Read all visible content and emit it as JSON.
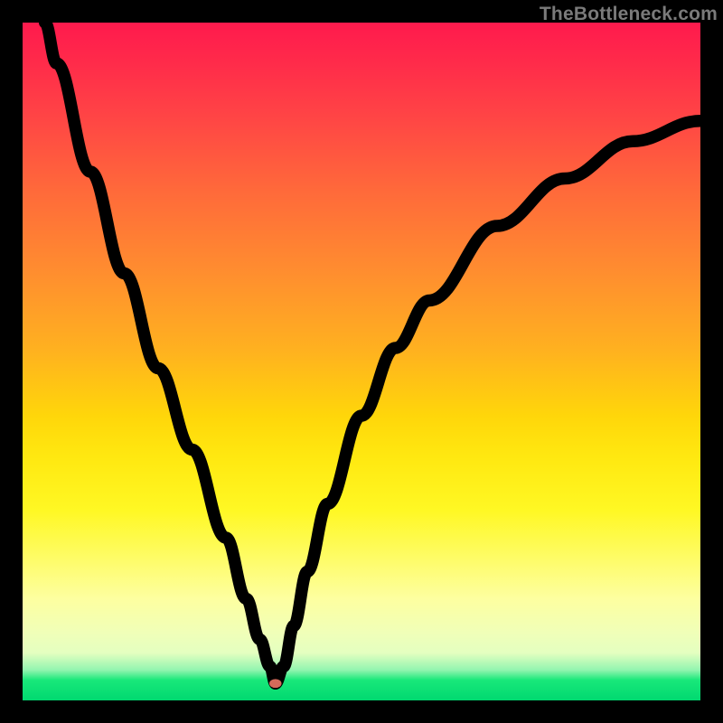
{
  "watermark": "TheBottleneck.com",
  "chart_data": {
    "type": "line",
    "title": "",
    "xlabel": "",
    "ylabel": "",
    "xlim": [
      0,
      100
    ],
    "ylim": [
      0,
      100
    ],
    "grid": false,
    "legend": false,
    "background": "rainbow-gradient-vertical",
    "marker": {
      "x": 37.3,
      "y": 2.5,
      "color": "#d46a5a"
    },
    "series": [
      {
        "name": "left-branch",
        "x": [
          3.3,
          5,
          10,
          15,
          20,
          25,
          30,
          33,
          35,
          36.5,
          37.3
        ],
        "y": [
          100,
          94,
          78,
          63,
          49,
          37,
          24,
          15,
          9,
          5,
          2.5
        ]
      },
      {
        "name": "right-branch",
        "x": [
          37.3,
          38.5,
          40,
          42,
          45,
          50,
          55,
          60,
          70,
          80,
          90,
          100
        ],
        "y": [
          2.5,
          5,
          11,
          19,
          29,
          42,
          52,
          59,
          70,
          77,
          82.5,
          85.5
        ]
      }
    ]
  }
}
